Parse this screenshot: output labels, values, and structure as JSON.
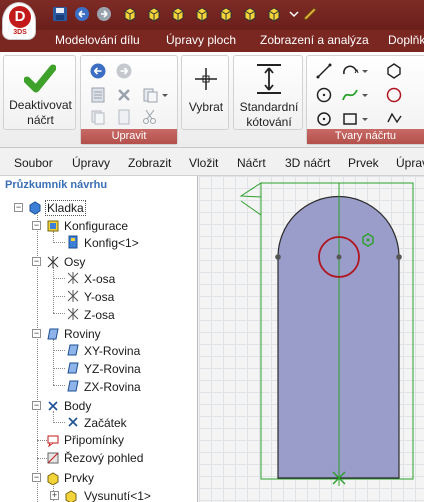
{
  "app": {
    "logo_letter": "D",
    "logo_sub": "3DS"
  },
  "ribbon_tabs": [
    "Modelování dílu",
    "Úpravy ploch",
    "Zobrazení a analýza",
    "Doplňk"
  ],
  "ribbon": {
    "deactivate_label_1": "Deaktivovat",
    "deactivate_label_2": "náčrt",
    "group_edit": "Upravit",
    "select_label": "Vybrat",
    "dimension_label_1": "Standardní",
    "dimension_label_2": "kótování",
    "group_shapes": "Tvary náčrtu"
  },
  "menu": [
    "Soubor",
    "Úpravy",
    "Zobrazit",
    "Vložit",
    "Náčrt",
    "3D náčrt",
    "Prvek",
    "Úprav"
  ],
  "panel": {
    "title": "Průzkumník návrhu"
  },
  "tree": {
    "root": "Kladka",
    "konfigurace": "Konfigurace",
    "konfig": "Konfig<1>",
    "osy": "Osy",
    "x_osa": "X-osa",
    "y_osa": "Y-osa",
    "z_osa": "Z-osa",
    "roviny": "Roviny",
    "xy": "XY-Rovina",
    "yz": "YZ-Rovina",
    "zx": "ZX-Rovina",
    "body": "Body",
    "zacatek": "Začátek",
    "pripominky": "Připomínky",
    "rezovy": "Řezový pohled",
    "prvky": "Prvky",
    "vysunuti": "Vysunutí<1>"
  },
  "colors": {
    "titlebar": "#7e2b26",
    "ribbon_group_label": "#b3504b",
    "sketch_fill": "#9a9cc9",
    "sketch_outline": "#2b2b2b",
    "circle": "#b0141e",
    "constraint_green": "#2aa02a"
  },
  "icons": [
    "save-icon",
    "undo-icon",
    "redo-icon",
    "cube-icon",
    "checkmark-icon",
    "crosshair-icon",
    "dimension-icon",
    "line-icon",
    "arc-icon",
    "polygon-icon",
    "circle-icon",
    "rectangle-icon",
    "spline-icon"
  ]
}
